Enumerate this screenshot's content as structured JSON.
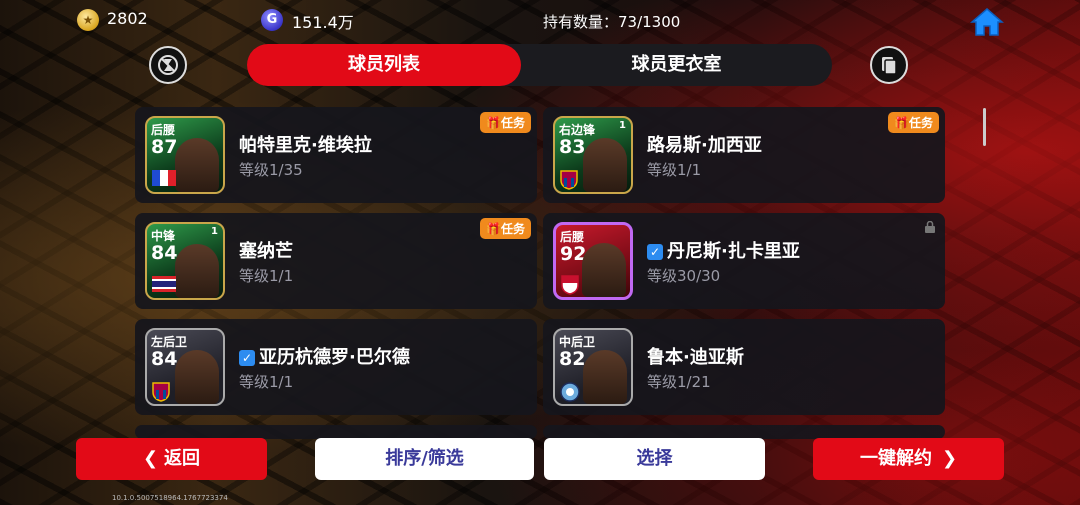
{
  "topbar": {
    "coin_value": "2802",
    "gp_value": "151.4万",
    "gp_icon_letter": "G",
    "holdings_label": "持有数量：73/1300",
    "coin_icon": "coin-icon",
    "home_icon": "home-icon"
  },
  "tabs": [
    {
      "label": "球员列表",
      "active": true
    },
    {
      "label": "球员更衣室",
      "active": false
    }
  ],
  "players": [
    {
      "position": "后腰",
      "rating": "87",
      "level_badge": "",
      "name": "帕特里克·维埃拉",
      "verified": false,
      "level": "等级1/35",
      "task": "任务",
      "locked": false,
      "card_style": "green",
      "flag": "france"
    },
    {
      "position": "右边锋",
      "rating": "83",
      "level_badge": "1",
      "name": "路易斯·加西亚",
      "verified": false,
      "level": "等级1/1",
      "task": "任务",
      "locked": false,
      "card_style": "green",
      "flag": "barcelona"
    },
    {
      "position": "中锋",
      "rating": "84",
      "level_badge": "1",
      "name": "塞纳芒",
      "verified": false,
      "level": "等级1/1",
      "task": "任务",
      "locked": false,
      "card_style": "green",
      "flag": "thailand"
    },
    {
      "position": "后腰",
      "rating": "92",
      "level_badge": "",
      "name": "丹尼斯·扎卡里亚",
      "verified": true,
      "level": "等级30/30",
      "task": "",
      "locked": true,
      "card_style": "red",
      "flag": "monaco"
    },
    {
      "position": "左后卫",
      "rating": "84",
      "level_badge": "",
      "name": "亚历杭德罗·巴尔德",
      "verified": true,
      "level": "等级1/1",
      "task": "",
      "locked": false,
      "card_style": "dark",
      "flag": "barcelona"
    },
    {
      "position": "中后卫",
      "rating": "82",
      "level_badge": "",
      "name": "鲁本·迪亚斯",
      "verified": false,
      "level": "等级1/21",
      "task": "",
      "locked": false,
      "card_style": "dark",
      "flag": "mancity"
    }
  ],
  "buttons": {
    "back": "返回",
    "sort_filter": "排序/筛选",
    "select": "选择",
    "release_all": "一键解约"
  },
  "version": "10.1.0.5007518964.1767723374",
  "colors": {
    "accent_red": "#e20a17",
    "task_orange": "#f08a1d",
    "verified_blue": "#2d8cf0"
  }
}
